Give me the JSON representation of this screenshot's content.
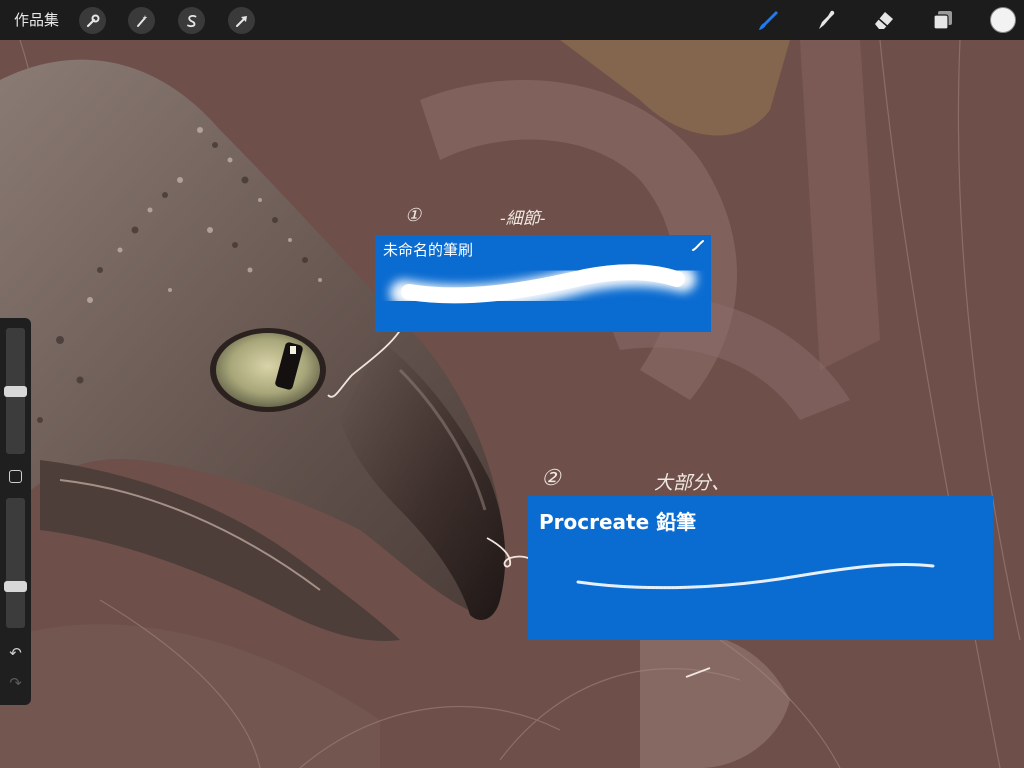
{
  "toolbar": {
    "gallery_label": "作品集",
    "left_tools": [
      {
        "icon": "wrench-icon"
      },
      {
        "icon": "magic-wand-icon"
      },
      {
        "icon": "selection-icon"
      },
      {
        "icon": "transform-arrow-icon"
      }
    ],
    "right_tools": [
      {
        "icon": "brush-icon",
        "active": true
      },
      {
        "icon": "smudge-icon"
      },
      {
        "icon": "eraser-icon"
      },
      {
        "icon": "layers-icon"
      }
    ],
    "current_color": "#f2f2f2",
    "accent_color": "#1f7cf2"
  },
  "sidebar": {
    "brush_size_level": 0.5,
    "opacity_level": 0.3,
    "undo_icon": "undo-icon",
    "redo_icon": "redo-icon"
  },
  "annotations": {
    "note1_number": "①",
    "note1_text": "-細節-",
    "note2_number": "②",
    "note2_text": "大部分、"
  },
  "brush_cards": [
    {
      "title": "未命名的筆刷",
      "badge_icon": "brush-shape-icon"
    },
    {
      "title": "Procreate 鉛筆"
    }
  ]
}
